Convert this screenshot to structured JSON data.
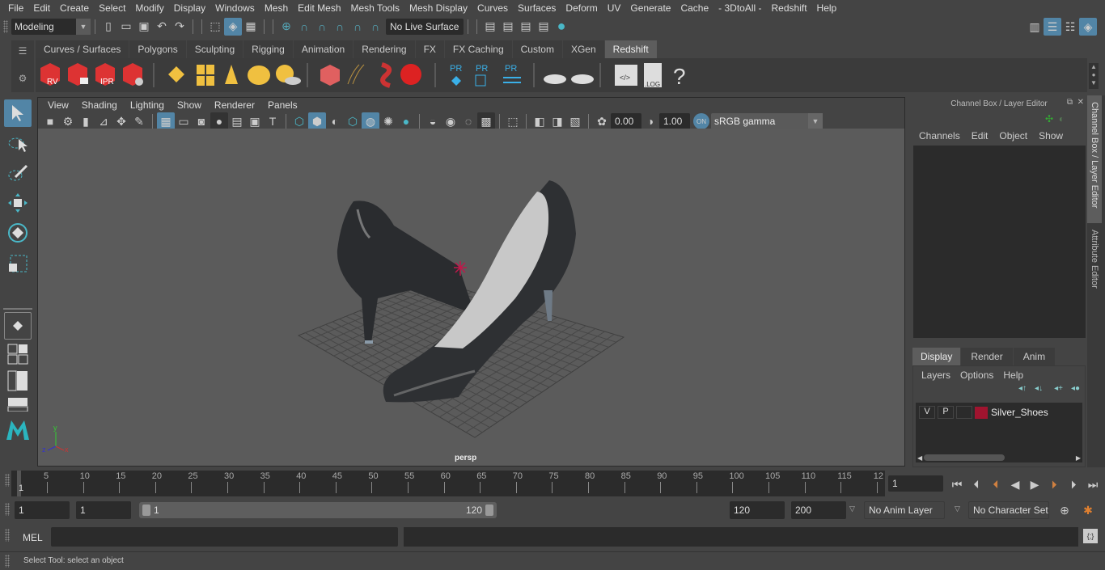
{
  "menubar": [
    "File",
    "Edit",
    "Create",
    "Select",
    "Modify",
    "Display",
    "Windows",
    "Mesh",
    "Edit Mesh",
    "Mesh Tools",
    "Mesh Display",
    "Curves",
    "Surfaces",
    "Deform",
    "UV",
    "Generate",
    "Cache",
    "- 3DtoAll -",
    "Redshift",
    "Help"
  ],
  "statusline": {
    "mode": "Modeling",
    "live_surface": "No Live Surface"
  },
  "shelf_tabs": [
    "Curves / Surfaces",
    "Polygons",
    "Sculpting",
    "Rigging",
    "Animation",
    "Rendering",
    "FX",
    "FX Caching",
    "Custom",
    "XGen",
    "Redshift"
  ],
  "shelf_active_tab": "Redshift",
  "shelf_icons": {
    "rv": "RV",
    "ipr": "IPR",
    "pr": "PR",
    "log": ".LOG",
    "help": "?"
  },
  "viewport": {
    "menus": [
      "View",
      "Shading",
      "Lighting",
      "Show",
      "Renderer",
      "Panels"
    ],
    "exposure": "0.00",
    "gamma": "1.00",
    "color_mgmt_on": "ON",
    "color_space": "sRGB gamma",
    "camera_label": "persp",
    "axis": {
      "x": "x",
      "y": "y",
      "z": "z"
    }
  },
  "channel_box": {
    "title": "Channel Box / Layer Editor",
    "menus": [
      "Channels",
      "Edit",
      "Object",
      "Show"
    ]
  },
  "layer_editor": {
    "tabs": [
      "Display",
      "Render",
      "Anim"
    ],
    "active_tab": "Display",
    "menus": [
      "Layers",
      "Options",
      "Help"
    ],
    "layers": [
      {
        "v": "V",
        "p": "P",
        "name": "Silver_Shoes",
        "color": "#a0142f"
      }
    ]
  },
  "side_tabs": [
    "Channel Box / Layer Editor",
    "Attribute Editor"
  ],
  "timeline": {
    "ticks": [
      "5",
      "10",
      "15",
      "20",
      "25",
      "30",
      "35",
      "40",
      "45",
      "50",
      "55",
      "60",
      "65",
      "70",
      "75",
      "80",
      "85",
      "90",
      "95",
      "100",
      "105",
      "110",
      "115",
      "12"
    ],
    "start_label": "1",
    "current_frame": "1"
  },
  "range": {
    "start": "1",
    "anim_start": "1",
    "slider_start": "1",
    "slider_end": "120",
    "end": "120",
    "anim_end": "200",
    "anim_layer": "No Anim Layer",
    "character_set": "No Character Set"
  },
  "cmdline": {
    "label": "MEL"
  },
  "help_line": "Select Tool: select an object"
}
